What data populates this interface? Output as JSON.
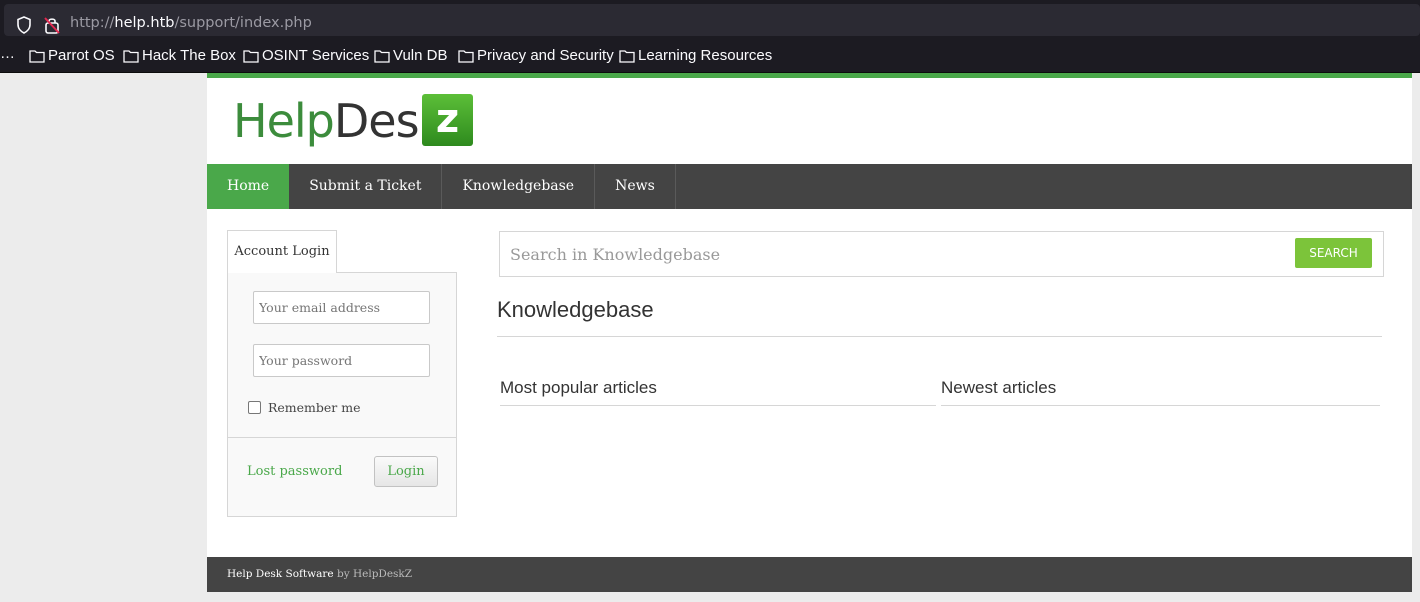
{
  "browser": {
    "url_prefix": "http://",
    "url_host": "help.htb",
    "url_path": "/support/index.php",
    "bookmarks_overflow": "…",
    "bookmarks": [
      "Parrot OS",
      "Hack The Box",
      "OSINT Services",
      "Vuln DB",
      "Privacy and Security",
      "Learning Resources"
    ]
  },
  "logo": {
    "help": "Help",
    "desk": "Desk",
    "z": "z"
  },
  "nav": [
    "Home",
    "Submit a Ticket",
    "Knowledgebase",
    "News"
  ],
  "login": {
    "tab": "Account Login",
    "email_placeholder": "Your email address",
    "password_placeholder": "Your password",
    "remember": "Remember me",
    "lost_password": "Lost password",
    "button": "Login"
  },
  "search": {
    "placeholder": "Search in Knowledgebase",
    "button": "SEARCH"
  },
  "kb": {
    "title": "Knowledgebase",
    "popular": "Most popular articles",
    "newest": "Newest articles"
  },
  "footer": {
    "software": "Help Desk Software",
    "by": "by HelpDeskZ"
  },
  "colors": {
    "accent": "#4aa84a",
    "nav_bg": "#444444",
    "search_btn": "#7cc43a"
  }
}
